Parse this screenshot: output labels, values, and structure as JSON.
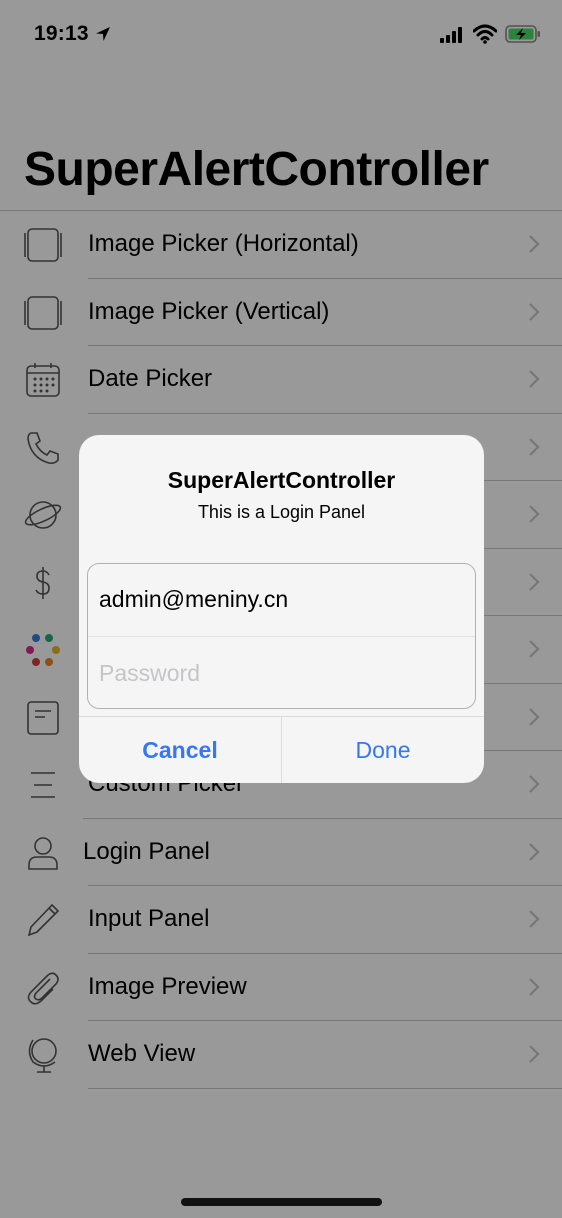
{
  "status_bar": {
    "time": "19:13"
  },
  "nav": {
    "title": "SuperAlertController"
  },
  "list": {
    "items": [
      {
        "label": "Image Picker (Horizontal)",
        "icon": "image-picker-horizontal-icon"
      },
      {
        "label": "Image Picker (Vertical)",
        "icon": "image-picker-vertical-icon"
      },
      {
        "label": "Date Picker",
        "icon": "calendar-icon"
      },
      {
        "label": "",
        "icon": "phone-icon"
      },
      {
        "label": "",
        "icon": "planet-icon"
      },
      {
        "label": "",
        "icon": "dollar-icon"
      },
      {
        "label": "",
        "icon": "color-dots-icon"
      },
      {
        "label": "",
        "icon": "note-icon"
      },
      {
        "label": "Custom Picker",
        "icon": "lines-icon"
      },
      {
        "label": "Login Panel",
        "icon": "person-icon"
      },
      {
        "label": "Input Panel",
        "icon": "pencil-icon"
      },
      {
        "label": "Image Preview",
        "icon": "paperclip-icon"
      },
      {
        "label": "Web View",
        "icon": "globe-icon"
      }
    ]
  },
  "alert": {
    "title": "SuperAlertController",
    "message": "This is a Login Panel",
    "email_value": "admin@meniny.cn",
    "password_placeholder": "Password",
    "cancel_label": "Cancel",
    "done_label": "Done"
  },
  "colors": {
    "accent": "#3478f6",
    "separator": "#c8c7cc",
    "dim_overlay": "rgba(0,0,0,0.40)"
  }
}
